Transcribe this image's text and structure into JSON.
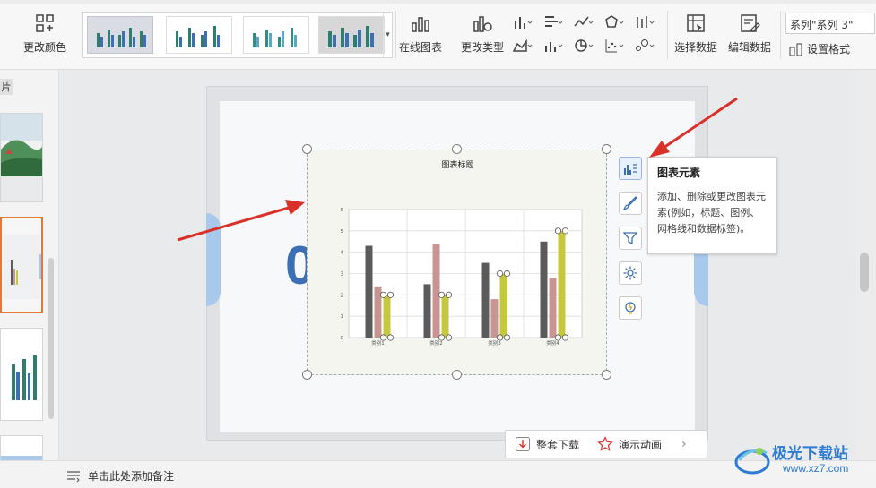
{
  "ribbon": {
    "change_color": "更改颜色",
    "online_chart": "在线图表",
    "change_type": "更改类型",
    "select_data": "选择数据",
    "edit_data": "编辑数据",
    "series_select": "系列\"系列 3\"",
    "set_format": "设置格式"
  },
  "left_panel": {
    "tab_label": "片"
  },
  "chart": {
    "title": "图表标题",
    "chart_data": {
      "type": "bar",
      "categories": [
        "类别1",
        "类别2",
        "类别3",
        "类别4"
      ],
      "series": [
        {
          "values": [
            4.3,
            2.5,
            3.5,
            4.5
          ],
          "color": "#5b5b5b"
        },
        {
          "values": [
            2.4,
            4.4,
            1.8,
            2.8
          ],
          "color": "#c99593"
        },
        {
          "values": [
            2,
            2,
            3,
            5
          ],
          "color": "#c5c73c"
        }
      ],
      "ylim": [
        0,
        6
      ],
      "yticks": [
        "0",
        "1",
        "2",
        "3",
        "4",
        "5",
        "6"
      ],
      "grid": true
    }
  },
  "tooltip": {
    "title": "图表元素",
    "body": "添加、删除或更改图表元素(例如，标题、图例、网格线和数据标签)。"
  },
  "bottom_actions": {
    "download": "整套下载",
    "animation": "演示动画"
  },
  "status": {
    "note": "单击此处添加备注"
  },
  "watermark": {
    "line1": "极光下载站",
    "line2": "www.xz7.com"
  },
  "colors": {
    "accent": "#d9312a",
    "brand": "#2d7bd3",
    "slide_active_border": "#e0793a"
  }
}
